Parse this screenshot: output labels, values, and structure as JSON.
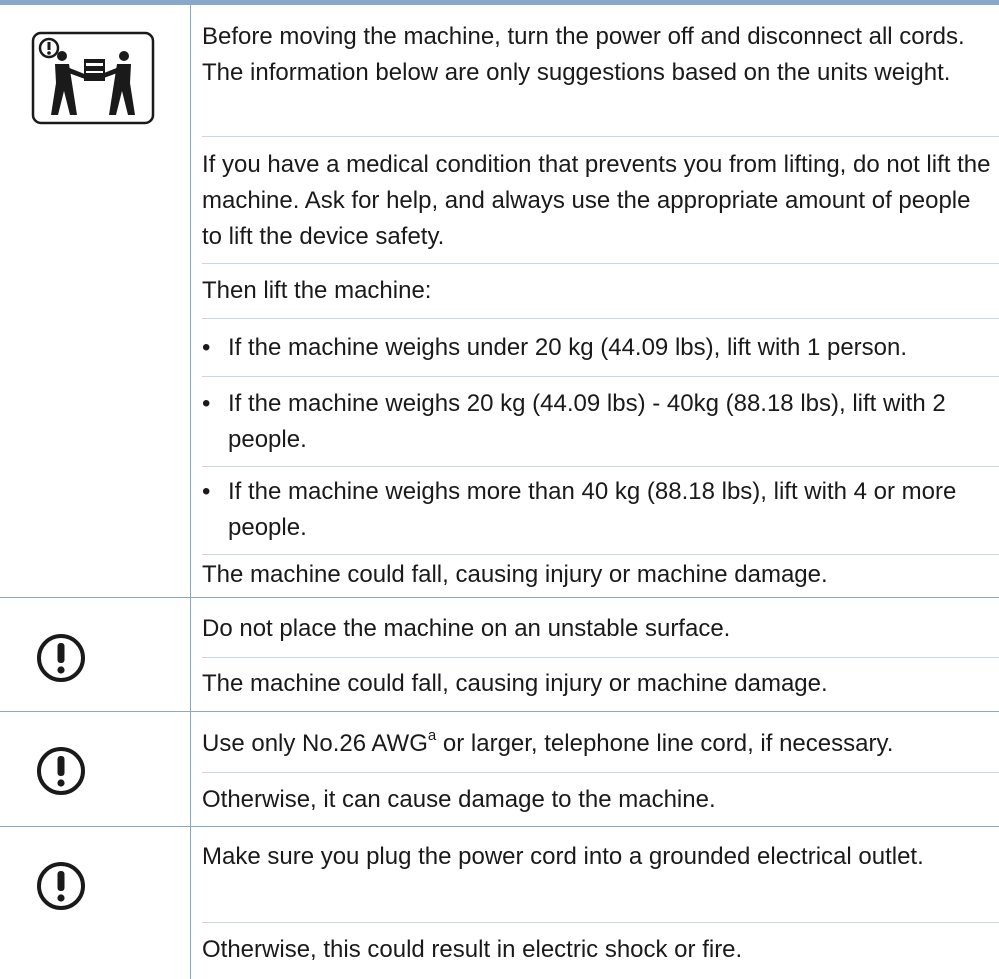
{
  "rows": [
    {
      "icon": "lifting-two-people-icon",
      "paragraphs": [
        "Before moving the machine, turn the power off and disconnect all cords. The information below are only suggestions based on the units weight.",
        "If you have a medical condition that prevents you from lifting, do not lift the machine. Ask for help, and always use the appropriate amount of people to lift the device safety.",
        "Then lift the machine:"
      ],
      "bullets": [
        "If the machine weighs under 20 kg (44.09 lbs), lift with 1 person.",
        "If the machine weighs 20 kg (44.09 lbs) - 40kg (88.18 lbs), lift with 2 people.",
        "If the machine weighs more than 40 kg (88.18 lbs), lift with 4 or more people."
      ],
      "closing": "The machine could fall, causing injury or machine damage."
    },
    {
      "icon": "caution-icon",
      "paragraphs": [
        "Do not place the machine on an unstable surface.",
        "The machine could fall, causing injury or machine damage."
      ]
    },
    {
      "icon": "caution-icon",
      "line_before_sup": "Use only No.26 AWG",
      "sup": "a",
      "line_after_sup": " or larger, telephone line cord, if necessary.",
      "paragraphs": [
        "Otherwise, it can cause damage to the machine."
      ]
    },
    {
      "icon": "caution-icon",
      "paragraphs": [
        "Make sure you plug the power cord into a grounded electrical outlet.",
        "Otherwise, this could result in electric shock or fire."
      ]
    }
  ],
  "bullet_glyph": "•",
  "colors": {
    "rule": "#8aa9c8",
    "separator": "#c9d6e3",
    "text": "#1a1a1a"
  }
}
